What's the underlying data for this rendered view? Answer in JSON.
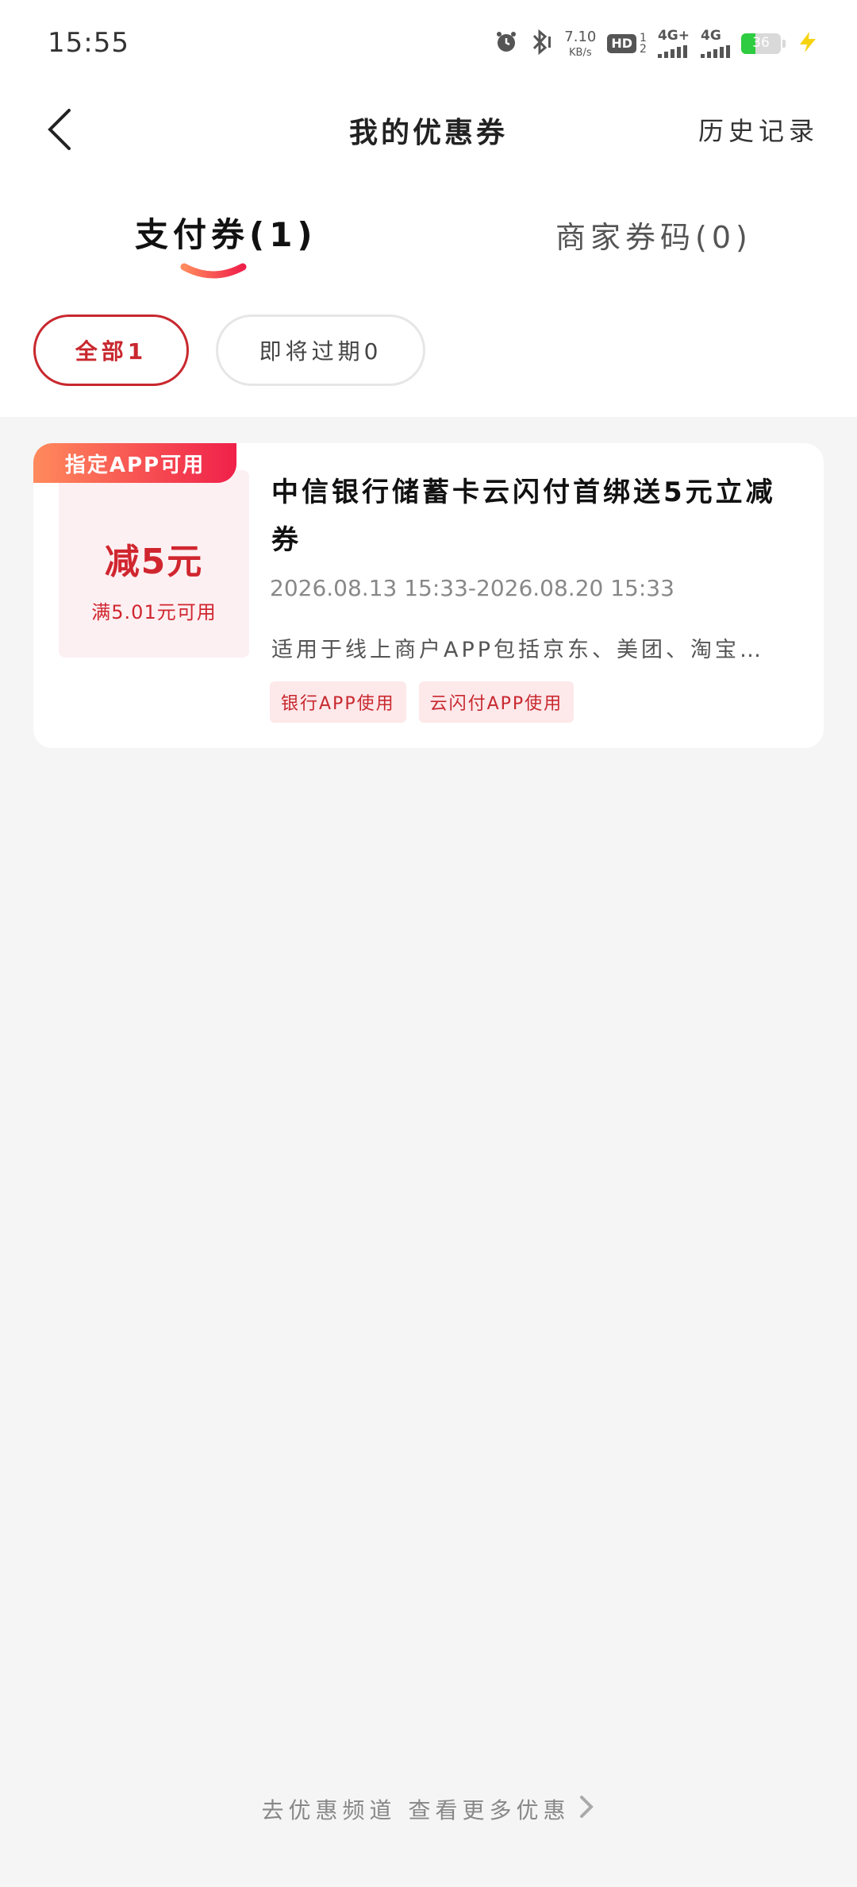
{
  "status_bar": {
    "time": "15:55",
    "net_speed_value": "7.10",
    "net_speed_unit": "KB/s",
    "hd_label": "HD",
    "hd_sub_top": "1",
    "hd_sub_bottom": "2",
    "net1_label": "4G+",
    "net2_label": "4G",
    "battery_level": "36",
    "icons": [
      "alarm-icon",
      "bluetooth-icon",
      "hd-icon",
      "signal-icon",
      "signal-icon",
      "battery-icon",
      "charging-icon"
    ]
  },
  "header": {
    "title": "我的优惠券",
    "history_label": "历史记录"
  },
  "tabs": [
    {
      "label": "支付券(1)",
      "active": true
    },
    {
      "label": "商家券码(0)",
      "active": false
    }
  ],
  "filters": [
    {
      "label": "全部1",
      "active": true
    },
    {
      "label": "即将过期0",
      "active": false
    }
  ],
  "coupons": [
    {
      "tag": "指定APP可用",
      "discount": "减5元",
      "condition": "满5.01元可用",
      "title": "中信银行储蓄卡云闪付首绑送5元立减券",
      "validity": "2026.08.13 15:33-2026.08.20 15:33",
      "description": "适用于线上商户APP包括京东、美团、淘宝…",
      "labels": [
        "银行APP使用",
        "云闪付APP使用"
      ]
    }
  ],
  "footer": {
    "link_label": "去优惠频道 查看更多优惠"
  },
  "colors": {
    "accent": "#c8282e",
    "tag_gradient_start": "#ff8a5c",
    "tag_gradient_end": "#f0204a",
    "background": "#f5f5f5"
  }
}
